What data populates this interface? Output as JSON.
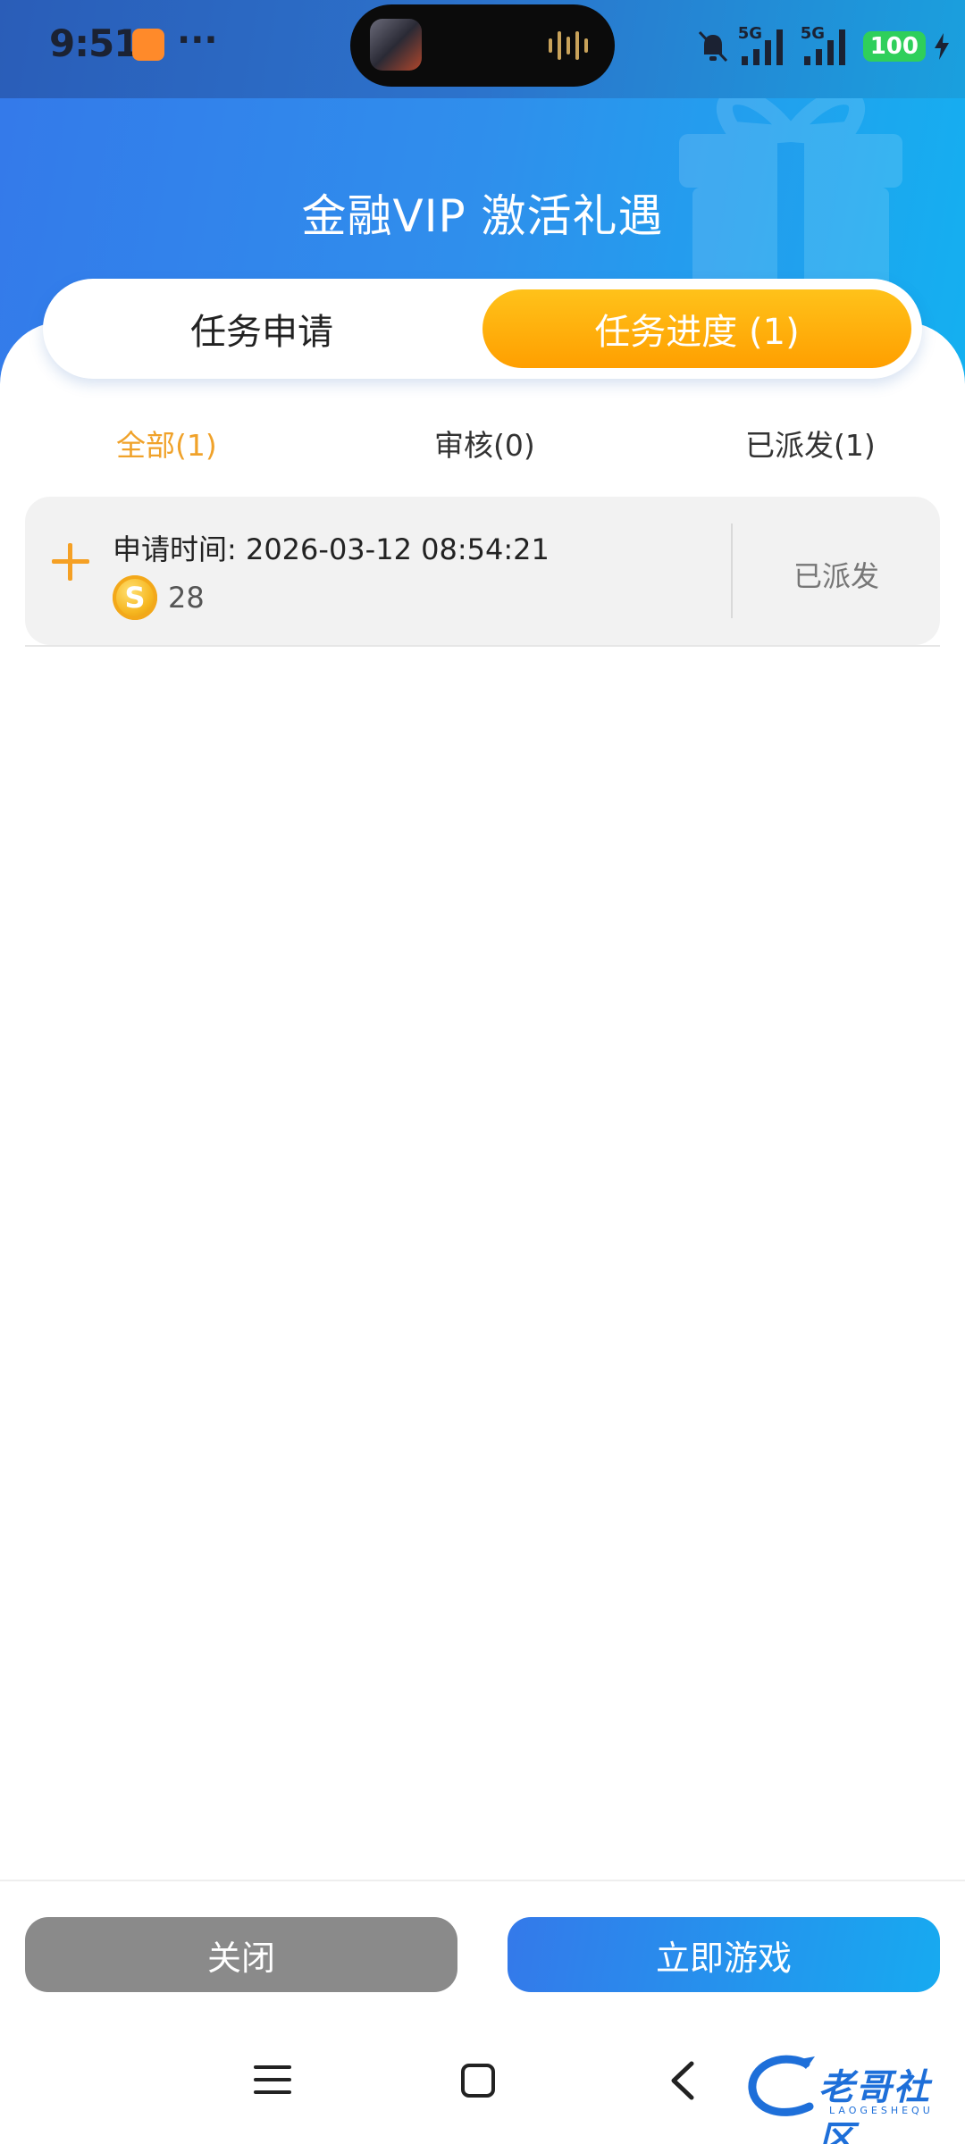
{
  "status_bar": {
    "time": "9:51",
    "more_indicator": "···",
    "network_1": "5G",
    "network_2": "5G",
    "battery": "100"
  },
  "header": {
    "title": "金融VIP 激活礼遇"
  },
  "main_tabs": [
    {
      "label": "任务申请",
      "active": false
    },
    {
      "label": "任务进度 (1)",
      "active": true
    }
  ],
  "filter_tabs": [
    {
      "label": "全部(1)",
      "active": true
    },
    {
      "label": "审核(0)",
      "active": false
    },
    {
      "label": "已派发(1)",
      "active": false
    }
  ],
  "records": [
    {
      "apply_time": "申请时间: 2026-03-12 08:54:21",
      "coin_symbol": "S",
      "amount": "28",
      "status": "已派发"
    }
  ],
  "footer": {
    "close_label": "关闭",
    "play_label": "立即游戏"
  },
  "watermark": {
    "text": "老哥社区",
    "sub": "LAOGESHEQU"
  },
  "colors": {
    "accent_blue": "#3479ea",
    "accent_orange": "#ff9f00",
    "active_filter": "#f0a22a",
    "close_button": "#8a8a8a"
  }
}
